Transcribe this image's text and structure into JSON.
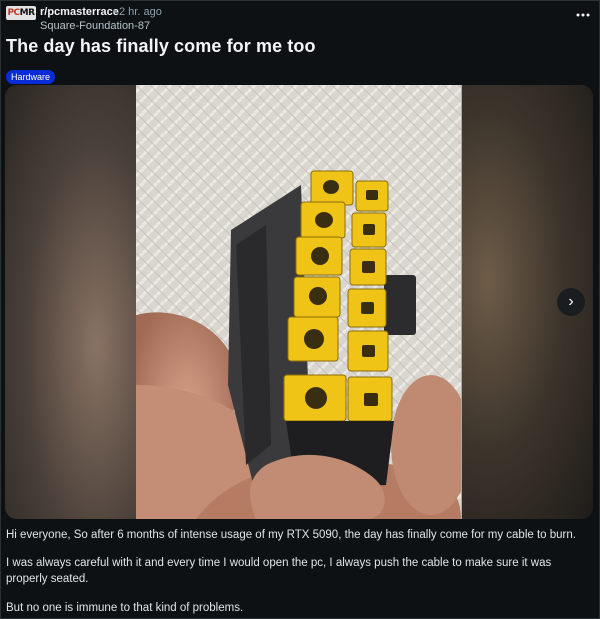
{
  "post": {
    "subreddit": "r/pcmasterrace",
    "separator": "•",
    "time": "2 hr. ago",
    "author": "Square-Foundation-87",
    "subreddit_icon": {
      "prefix": "PC",
      "suffix": "MR",
      "name": "pcmr-logo-icon"
    },
    "more_icon": "more-horizontal-icon",
    "title": "The day has finally come for me too",
    "flair": {
      "label": "Hardware",
      "color": "#0a2bd8"
    },
    "media": {
      "next_icon": "chevron-right-icon",
      "next_glyph": "›",
      "pages": 2,
      "current_page": 1
    },
    "paragraphs": [
      "Hi everyone, So after 6 months of intense usage of my RTX 5090, the day has finally come for my cable to burn.",
      "I was always careful with it and every time I would open the pc, I always push the cable to make sure it was properly seated.",
      "But no one is immune to that kind of problems."
    ]
  },
  "colors": {
    "background": "#0e1113",
    "text_primary": "#f2f4f5",
    "text_secondary": "#8ba2ad",
    "connector_yellow": "#f0c417"
  }
}
